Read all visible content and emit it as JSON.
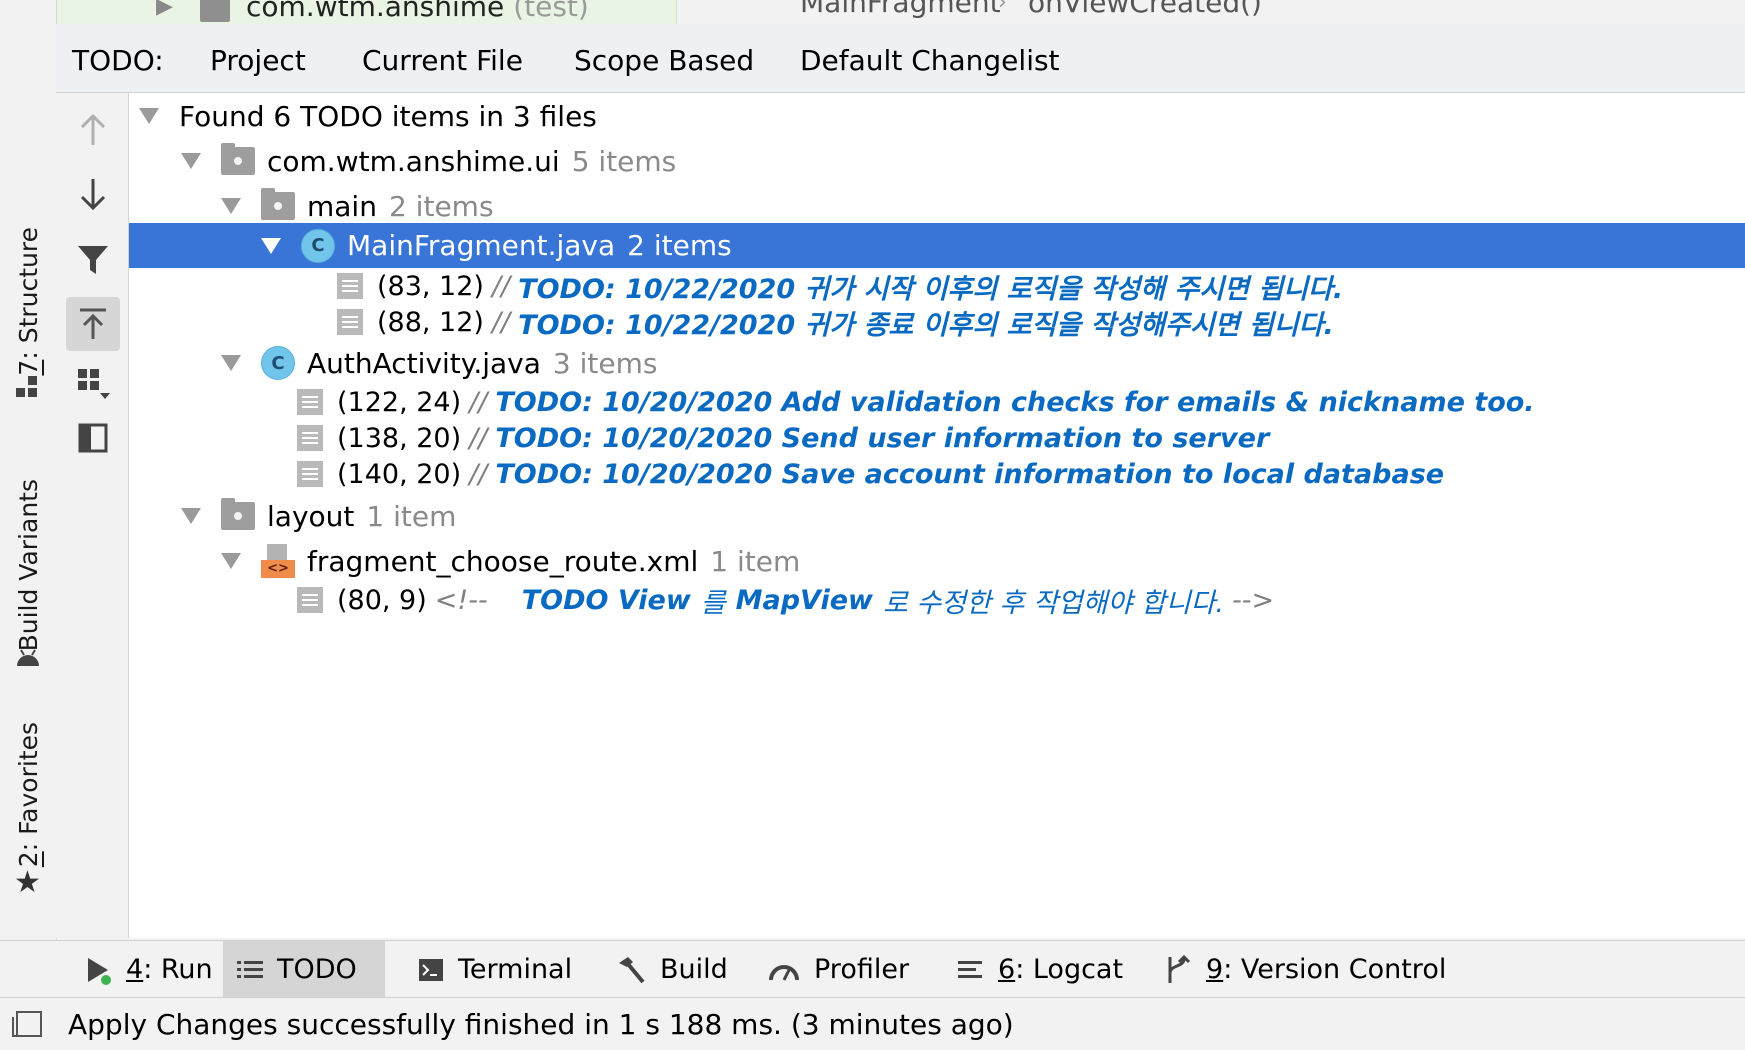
{
  "top_strip": {
    "project_node": "com.wtm.anshime",
    "project_node_suffix": "(test)",
    "breadcrumb": [
      "MainFragment",
      "onViewCreated()"
    ]
  },
  "left_strip": {
    "tabs": [
      {
        "number": "7",
        "label": ": Structure"
      },
      {
        "label": "Build Variants"
      },
      {
        "number": "2",
        "label": ": Favorites"
      }
    ]
  },
  "todo_header": {
    "label": "TODO:",
    "tabs": [
      "Project",
      "Current File",
      "Scope Based",
      "Default Changelist"
    ],
    "active_tab": "Project"
  },
  "tree": {
    "root": "Found 6 TODO items in 3 files",
    "pkg_ui": {
      "name": "com.wtm.anshime.ui",
      "count": "5 items"
    },
    "main": {
      "name": "main",
      "count": "2 items"
    },
    "mainfragment": {
      "name": "MainFragment.java",
      "count": "2 items",
      "items": [
        {
          "pos": "(83, 12)",
          "prefix": "//",
          "todo": "TODO: 10/22/2020 귀가 시작 이후의 로직을 작성해 주시면 됩니다."
        },
        {
          "pos": "(88, 12)",
          "prefix": "//",
          "todo": "TODO: 10/22/2020 귀가 종료 이후의 로직을 작성해주시면 됩니다."
        }
      ]
    },
    "authactivity": {
      "name": "AuthActivity.java",
      "count": "3 items",
      "items": [
        {
          "pos": "(122, 24)",
          "prefix": "//",
          "todo": "TODO: 10/20/2020 Add validation checks for emails & nickname too."
        },
        {
          "pos": "(138, 20)",
          "prefix": "//",
          "todo": "TODO: 10/20/2020 Send user information to server"
        },
        {
          "pos": "(140, 20)",
          "prefix": "//",
          "todo": "TODO: 10/20/2020 Save account information to local database"
        }
      ]
    },
    "layout": {
      "name": "layout",
      "count": "1 item"
    },
    "fragment_xml": {
      "name": "fragment_choose_route.xml",
      "count": "1 item",
      "items": [
        {
          "pos": "(80, 9)",
          "prefix": "<!--",
          "todo_bold_1": "TODO View",
          "todo_rest_1": "를",
          "todo_bold_2": "MapView",
          "todo_rest_2": "로 수정한 후 작업해야 합니다.",
          "suffix": "-->"
        }
      ]
    }
  },
  "bottom_bar": {
    "tabs": [
      {
        "key": "4",
        "label": ": Run"
      },
      {
        "label": "TODO"
      },
      {
        "label": "Terminal"
      },
      {
        "label": "Build"
      },
      {
        "label": "Profiler"
      },
      {
        "key": "6",
        "label": ": Logcat"
      },
      {
        "key": "9",
        "label": ": Version Control"
      }
    ],
    "active": "TODO"
  },
  "status_bar": {
    "message": "Apply Changes successfully finished in 1 s 188 ms. (3 minutes ago)"
  },
  "colors": {
    "selection": "#3875d7",
    "todo_text": "#0a6ac2",
    "tab_underline": "#4a86d7",
    "run_dot": "#3fb34f"
  }
}
